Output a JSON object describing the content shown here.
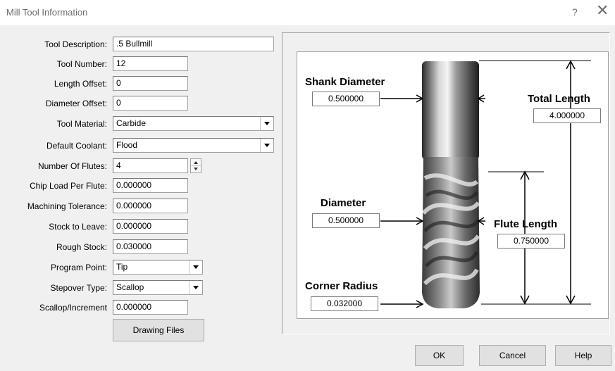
{
  "window": {
    "title": "Mill Tool Information",
    "help_glyph": "?",
    "close_glyph": "✕"
  },
  "form": {
    "tool_description": {
      "label": "Tool Description:",
      "value": ".5 Bullmill"
    },
    "tool_number": {
      "label": "Tool Number:",
      "value": "12"
    },
    "length_offset": {
      "label": "Length Offset:",
      "value": "0"
    },
    "diameter_offset": {
      "label": "Diameter Offset:",
      "value": "0"
    },
    "tool_material": {
      "label": "Tool Material:",
      "value": "Carbide"
    },
    "default_coolant": {
      "label": "Default Coolant:",
      "value": "Flood"
    },
    "number_of_flutes": {
      "label": "Number Of Flutes:",
      "value": "4"
    },
    "chip_load": {
      "label": "Chip Load Per Flute:",
      "value": "0.000000"
    },
    "machining_tolerance": {
      "label": "Machining Tolerance:",
      "value": "0.000000"
    },
    "stock_to_leave": {
      "label": "Stock to Leave:",
      "value": "0.000000"
    },
    "rough_stock": {
      "label": "Rough Stock:",
      "value": "0.030000"
    },
    "program_point": {
      "label": "Program Point:",
      "value": "Tip"
    },
    "stepover_type": {
      "label": "Stepover Type:",
      "value": "Scallop"
    },
    "scallop_increment": {
      "label": "Scallop/Increment",
      "value": "0.000000"
    },
    "drawing_files_label": "Drawing Files"
  },
  "diagram": {
    "shank_diameter": {
      "label": "Shank Diameter",
      "value": "0.500000"
    },
    "total_length": {
      "label": "Total Length",
      "value": "4.000000"
    },
    "diameter": {
      "label": "Diameter",
      "value": "0.500000"
    },
    "flute_length": {
      "label": "Flute Length",
      "value": "0.750000"
    },
    "corner_radius": {
      "label": "Corner Radius",
      "value": "0.032000"
    }
  },
  "footer": {
    "ok_label": "OK",
    "cancel_label": "Cancel",
    "help_label": "Help"
  }
}
